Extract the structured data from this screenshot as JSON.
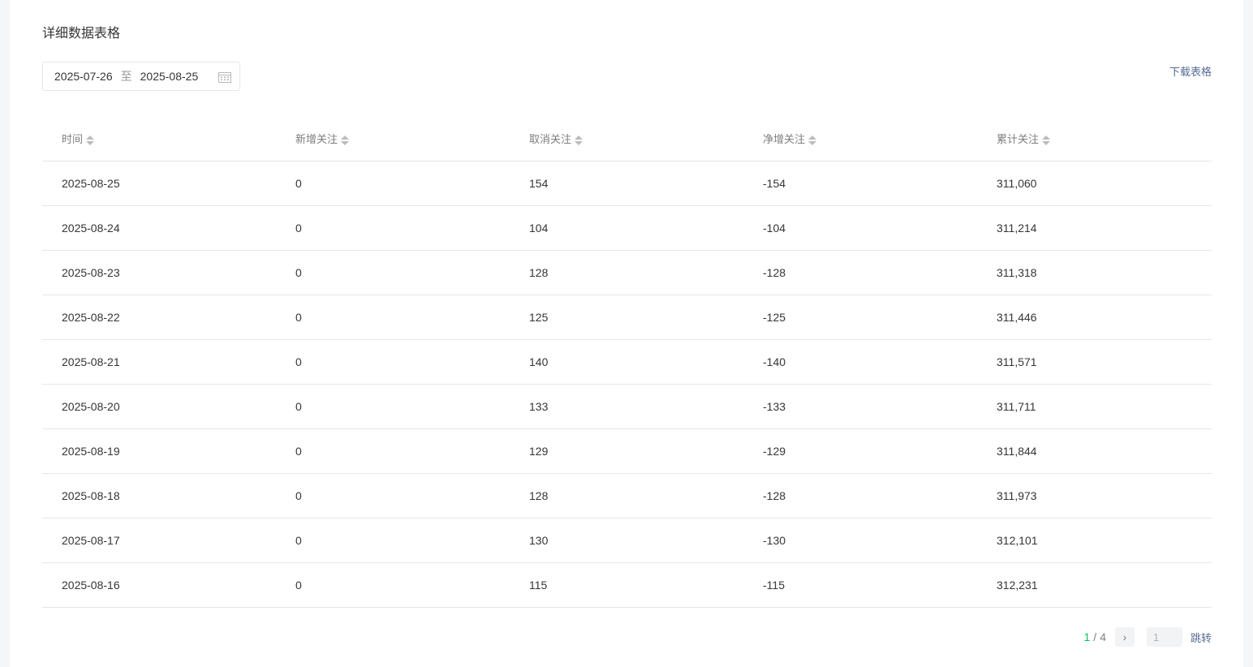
{
  "section": {
    "title": "详细数据表格",
    "download_label": "下载表格"
  },
  "date_range": {
    "start": "2025-07-26",
    "separator": "至",
    "end": "2025-08-25"
  },
  "table": {
    "headers": [
      "时间",
      "新增关注",
      "取消关注",
      "净增关注",
      "累计关注"
    ],
    "rows": [
      [
        "2025-08-25",
        "0",
        "154",
        "-154",
        "311,060"
      ],
      [
        "2025-08-24",
        "0",
        "104",
        "-104",
        "311,214"
      ],
      [
        "2025-08-23",
        "0",
        "128",
        "-128",
        "311,318"
      ],
      [
        "2025-08-22",
        "0",
        "125",
        "-125",
        "311,446"
      ],
      [
        "2025-08-21",
        "0",
        "140",
        "-140",
        "311,571"
      ],
      [
        "2025-08-20",
        "0",
        "133",
        "-133",
        "311,711"
      ],
      [
        "2025-08-19",
        "0",
        "129",
        "-129",
        "311,844"
      ],
      [
        "2025-08-18",
        "0",
        "128",
        "-128",
        "311,973"
      ],
      [
        "2025-08-17",
        "0",
        "130",
        "-130",
        "312,101"
      ],
      [
        "2025-08-16",
        "0",
        "115",
        "-115",
        "312,231"
      ]
    ]
  },
  "pagination": {
    "current": "1",
    "separator": "/",
    "total": "4",
    "next_glyph": "›",
    "jump_placeholder": "1",
    "jump_label": "跳转"
  },
  "colors": {
    "accent_green": "#07c160",
    "link_blue": "#576b95"
  }
}
